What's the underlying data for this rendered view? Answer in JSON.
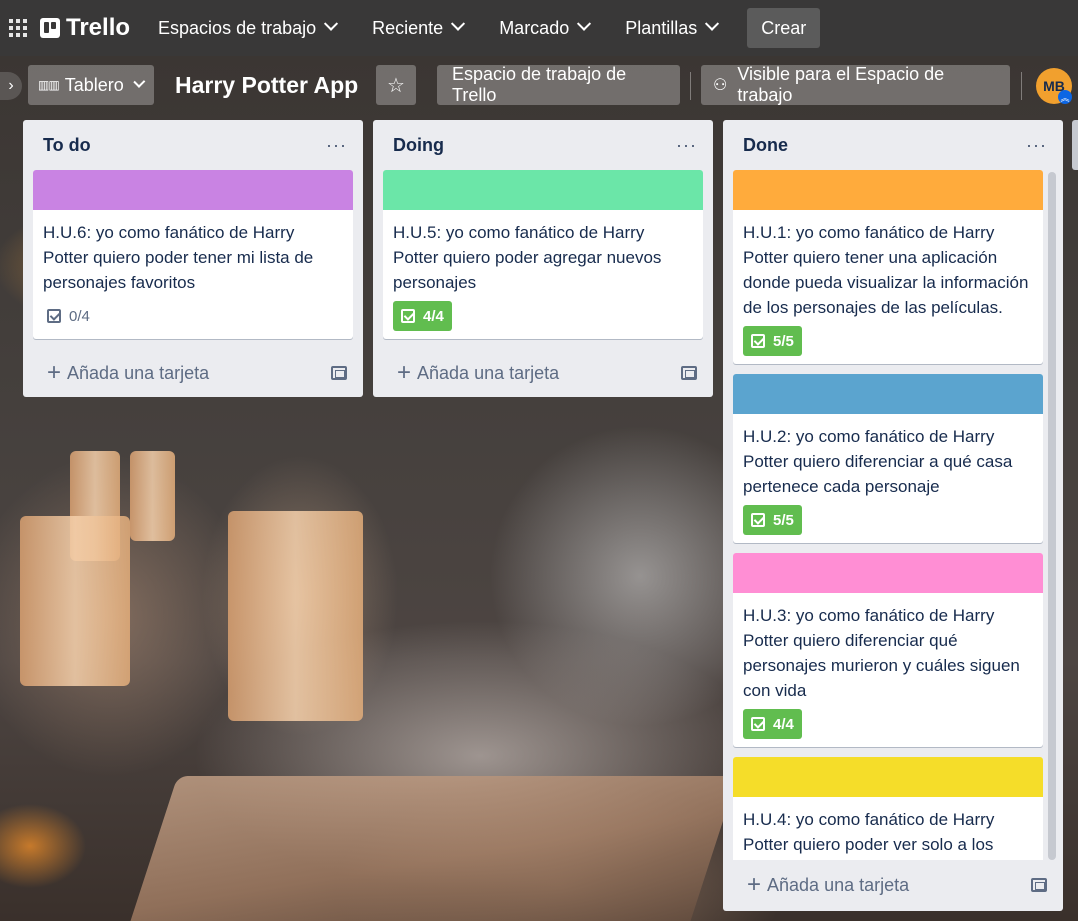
{
  "nav": {
    "brand": "Trello",
    "items": [
      {
        "label": "Espacios de trabajo"
      },
      {
        "label": "Reciente"
      },
      {
        "label": "Marcado"
      },
      {
        "label": "Plantillas"
      }
    ],
    "create_label": "Crear"
  },
  "board": {
    "view_label": "Tablero",
    "title": "Harry Potter App",
    "workspace_label": "Espacio de trabajo de Trello",
    "visibility_label": "Visible para el Espacio de trabajo",
    "avatar_initials": "MB"
  },
  "lists": [
    {
      "title": "To do",
      "cards": [
        {
          "cover": "#c983e3",
          "text": "H.U.6: yo como fanático de Harry Potter quiero poder tener mi lista de personajes favoritos",
          "checklist": "0/4",
          "complete": false
        }
      ],
      "add_label": "Añada una tarjeta"
    },
    {
      "title": "Doing",
      "cards": [
        {
          "cover": "#6be6a8",
          "text": "H.U.5: yo como fanático de Harry Potter quiero poder agregar nuevos personajes",
          "checklist": "4/4",
          "complete": true
        }
      ],
      "add_label": "Añada una tarjeta"
    },
    {
      "title": "Done",
      "cards": [
        {
          "cover": "#ffab3c",
          "text": "H.U.1: yo como fanático de Harry Potter quiero tener una aplicación donde pueda visualizar la información de los personajes de las películas.",
          "checklist": "5/5",
          "complete": true
        },
        {
          "cover": "#5ba4cf",
          "text": "H.U.2: yo como fanático de Harry Potter quiero diferenciar a qué casa pertenece cada personaje",
          "checklist": "5/5",
          "complete": true
        },
        {
          "cover": "#ff8ed4",
          "text": "H.U.3: yo como fanático de Harry Potter quiero diferenciar qué personajes murieron y cuáles siguen con vida",
          "checklist": "4/4",
          "complete": true
        },
        {
          "cover": "#f5dd29",
          "text": "H.U.4: yo como fanático de Harry Potter quiero poder ver solo a los",
          "checklist": "",
          "complete": false
        }
      ],
      "add_label": "Añada una tarjeta"
    }
  ],
  "colors": {
    "nav_bg": "#393838",
    "list_bg": "#ebecf0",
    "complete_badge": "#61bd4f"
  }
}
